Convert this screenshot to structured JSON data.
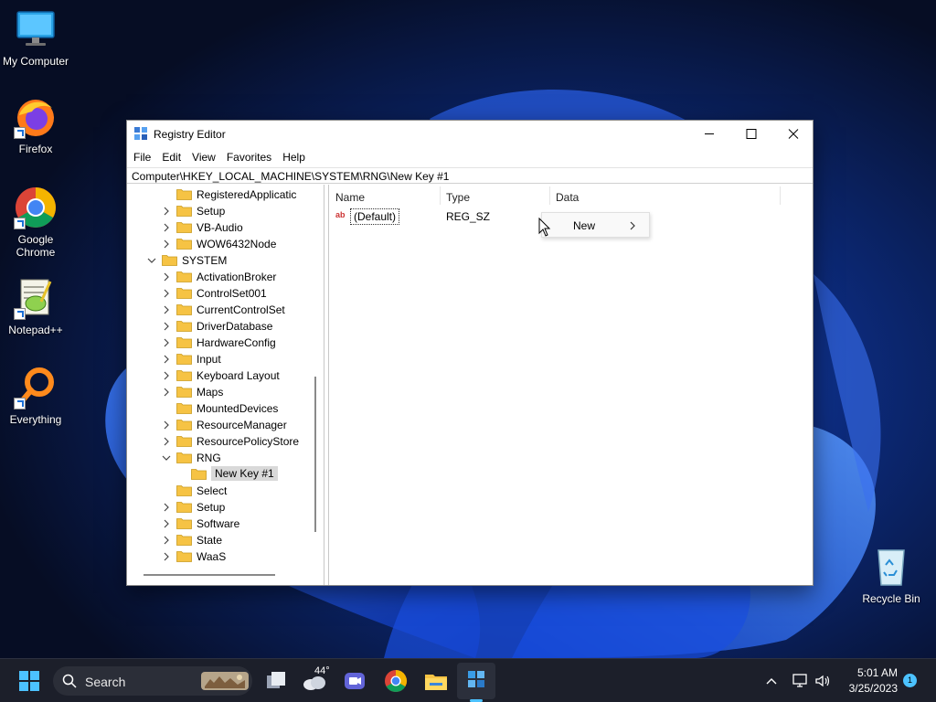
{
  "desktop": {
    "icons": [
      {
        "label": "My Computer"
      },
      {
        "label": "Firefox"
      },
      {
        "label": "Google\nChrome"
      },
      {
        "label": "Notepad++"
      },
      {
        "label": "Everything"
      },
      {
        "label": "Recycle Bin"
      }
    ]
  },
  "window": {
    "title": "Registry Editor",
    "menu": [
      "File",
      "Edit",
      "View",
      "Favorites",
      "Help"
    ],
    "address": "Computer\\HKEY_LOCAL_MACHINE\\SYSTEM\\RNG\\New Key #1",
    "tree": [
      {
        "label": "RegisteredApplicatic",
        "state": "leaf"
      },
      {
        "label": "Setup",
        "state": "collapsed"
      },
      {
        "label": "VB-Audio",
        "state": "collapsed"
      },
      {
        "label": "WOW6432Node",
        "state": "collapsed"
      },
      {
        "label": "SYSTEM",
        "state": "expanded"
      },
      {
        "label": "ActivationBroker",
        "state": "collapsed"
      },
      {
        "label": "ControlSet001",
        "state": "collapsed"
      },
      {
        "label": "CurrentControlSet",
        "state": "collapsed"
      },
      {
        "label": "DriverDatabase",
        "state": "collapsed"
      },
      {
        "label": "HardwareConfig",
        "state": "collapsed"
      },
      {
        "label": "Input",
        "state": "collapsed"
      },
      {
        "label": "Keyboard Layout",
        "state": "collapsed"
      },
      {
        "label": "Maps",
        "state": "collapsed"
      },
      {
        "label": "MountedDevices",
        "state": "leaf"
      },
      {
        "label": "ResourceManager",
        "state": "collapsed"
      },
      {
        "label": "ResourcePolicyStore",
        "state": "collapsed"
      },
      {
        "label": "RNG",
        "state": "expanded"
      },
      {
        "label": "New Key #1",
        "state": "selected"
      },
      {
        "label": "Select",
        "state": "leaf"
      },
      {
        "label": "Setup",
        "state": "collapsed"
      },
      {
        "label": "Software",
        "state": "collapsed"
      },
      {
        "label": "State",
        "state": "collapsed"
      },
      {
        "label": "WaaS",
        "state": "collapsed"
      }
    ],
    "columns": {
      "name": "Name",
      "type": "Type",
      "data": "Data"
    },
    "values": [
      {
        "icon": "ab",
        "name": "(Default)",
        "type": "REG_SZ",
        "data": ""
      }
    ]
  },
  "context_menu": {
    "items": [
      {
        "label": "New",
        "has_submenu": true
      }
    ]
  },
  "taskbar": {
    "search_label": "Search",
    "weather": "44°",
    "clock_time": "5:01 AM",
    "clock_date": "3/25/2023",
    "notification_count": "1"
  },
  "colors": {
    "accent": "#4cc2ff",
    "folder": "#f6c344",
    "taskbar": "#1c1f2a"
  }
}
